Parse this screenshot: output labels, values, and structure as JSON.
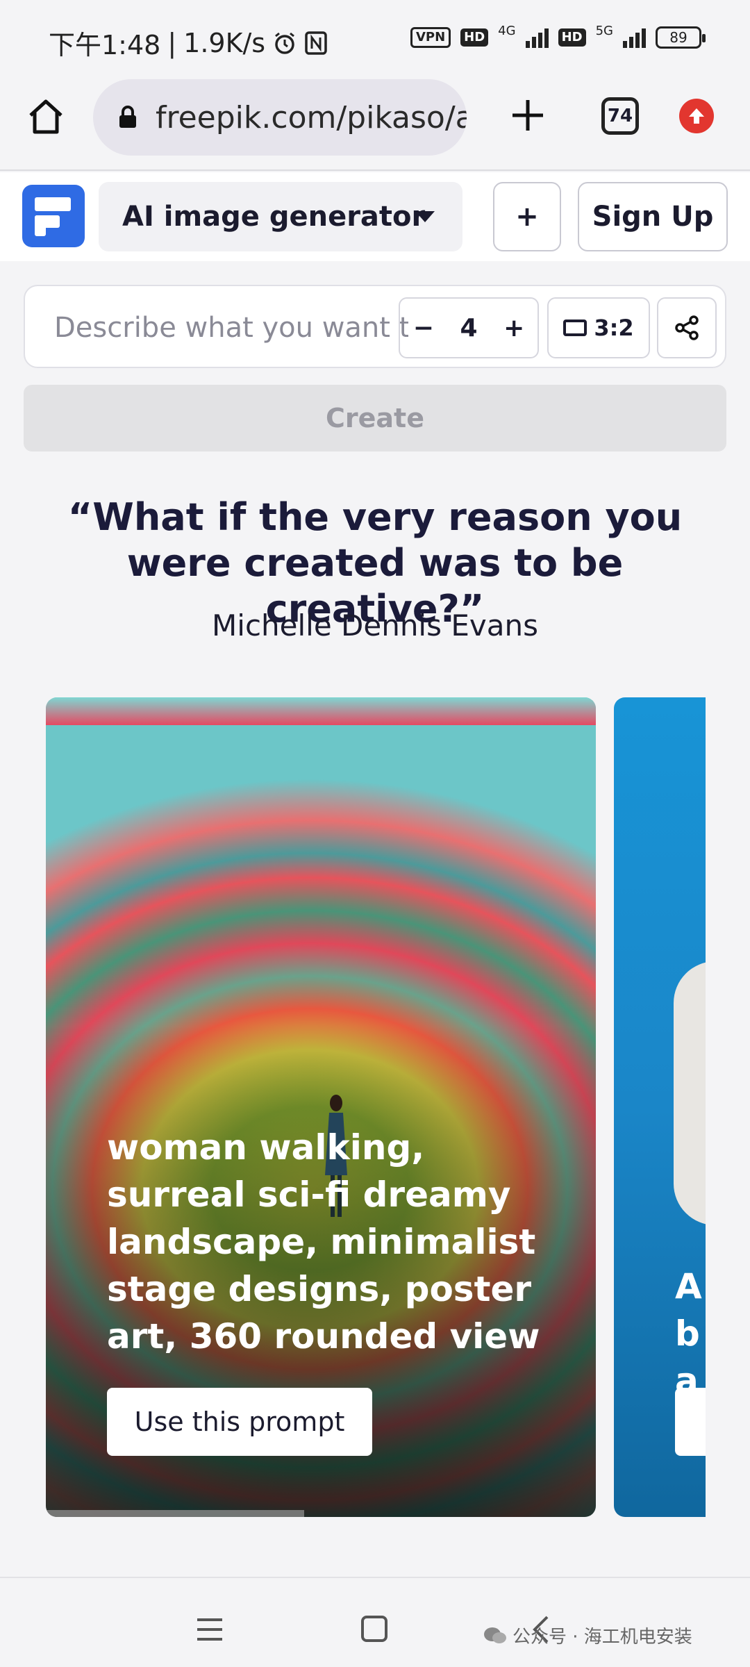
{
  "status_bar": {
    "time": "下午1:48",
    "speed": "1.9K/s",
    "vpn": "VPN",
    "hd": "HD",
    "net1": "4G",
    "net2": "5G",
    "battery": "89"
  },
  "browser": {
    "url": "freepik.com/pikaso/ai-image-generator",
    "tab_count": "74"
  },
  "header": {
    "tool_label": "AI image generator",
    "plus_label": "+",
    "signup_label": "Sign Up"
  },
  "prompt": {
    "placeholder": "Describe what you want to create",
    "quantity": "4",
    "minus": "−",
    "plus": "+",
    "ratio": "3:2",
    "create_label": "Create"
  },
  "quote": {
    "text": "“What if the very reason you were created was to be creative?”",
    "author": "Michelle Dennis Evans"
  },
  "carousel": {
    "cards": [
      {
        "prompt": "woman walking, surreal sci-fi dreamy landscape, minimalist stage designs, poster art, 360 rounded view",
        "button": "Use this prompt"
      },
      {
        "prompt": "A ba"
      }
    ],
    "progress_fraction": 0.47
  },
  "bottom_nav": {
    "watermark": "公众号 · 海工机电安装"
  }
}
